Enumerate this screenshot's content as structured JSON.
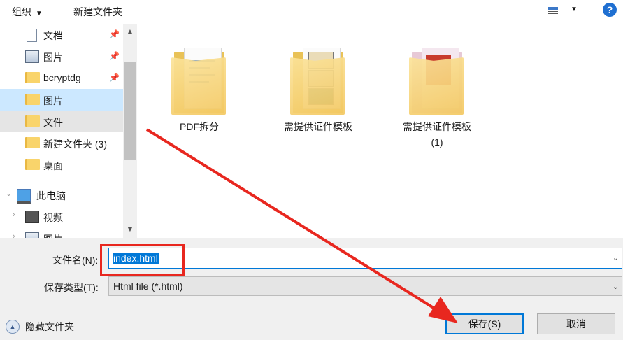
{
  "toolbar": {
    "organize_label": "组织",
    "new_folder_label": "新建文件夹",
    "help_label": "?"
  },
  "nav": {
    "items": [
      {
        "label": "文档",
        "icon": "document-icon",
        "pinned": true
      },
      {
        "label": "图片",
        "icon": "picture-icon",
        "pinned": true
      },
      {
        "label": "bcryptdg",
        "icon": "folder-icon",
        "pinned": true
      },
      {
        "label": "图片",
        "icon": "folder-icon",
        "state": "selected"
      },
      {
        "label": "文件",
        "icon": "folder-icon",
        "state": "hover"
      },
      {
        "label": "新建文件夹 (3)",
        "icon": "folder-icon"
      },
      {
        "label": "桌面",
        "icon": "folder-icon"
      },
      {
        "label": "此电脑",
        "icon": "computer-icon"
      },
      {
        "label": "视频",
        "icon": "video-icon"
      },
      {
        "label": "图片",
        "icon": "picture-icon"
      }
    ]
  },
  "content": {
    "files": [
      {
        "name": "PDF拆分"
      },
      {
        "name": "需提供证件模板"
      },
      {
        "name": "需提供证件模板\n(1)"
      }
    ]
  },
  "form": {
    "filename_label": "文件名(N):",
    "filename_value": "index.html",
    "filetype_label": "保存类型(T):",
    "filetype_value": "Html file (*.html)"
  },
  "footer": {
    "hide_folders_label": "隐藏文件夹",
    "save_label": "保存(S)",
    "cancel_label": "取消"
  },
  "annotation": {
    "color": "#e8271f"
  }
}
